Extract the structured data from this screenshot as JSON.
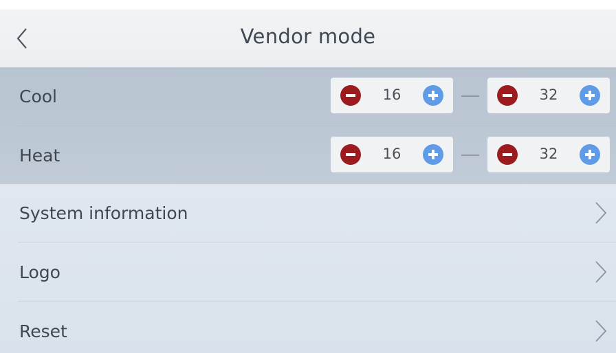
{
  "header": {
    "title": "Vendor mode",
    "back_icon": "chevron-left-icon"
  },
  "ranges": [
    {
      "label": "Cool",
      "min": "16",
      "max": "32"
    },
    {
      "label": "Heat",
      "min": "16",
      "max": "32"
    }
  ],
  "menu": [
    {
      "label": "System information",
      "icon": "chevron-right-icon"
    },
    {
      "label": "Logo",
      "icon": "chevron-right-icon"
    },
    {
      "label": "Reset",
      "icon": "chevron-right-icon"
    }
  ],
  "colors": {
    "minus_button": "#9b1b1f",
    "plus_button": "#5f9be6",
    "selected_band": "#bcc7d4"
  }
}
